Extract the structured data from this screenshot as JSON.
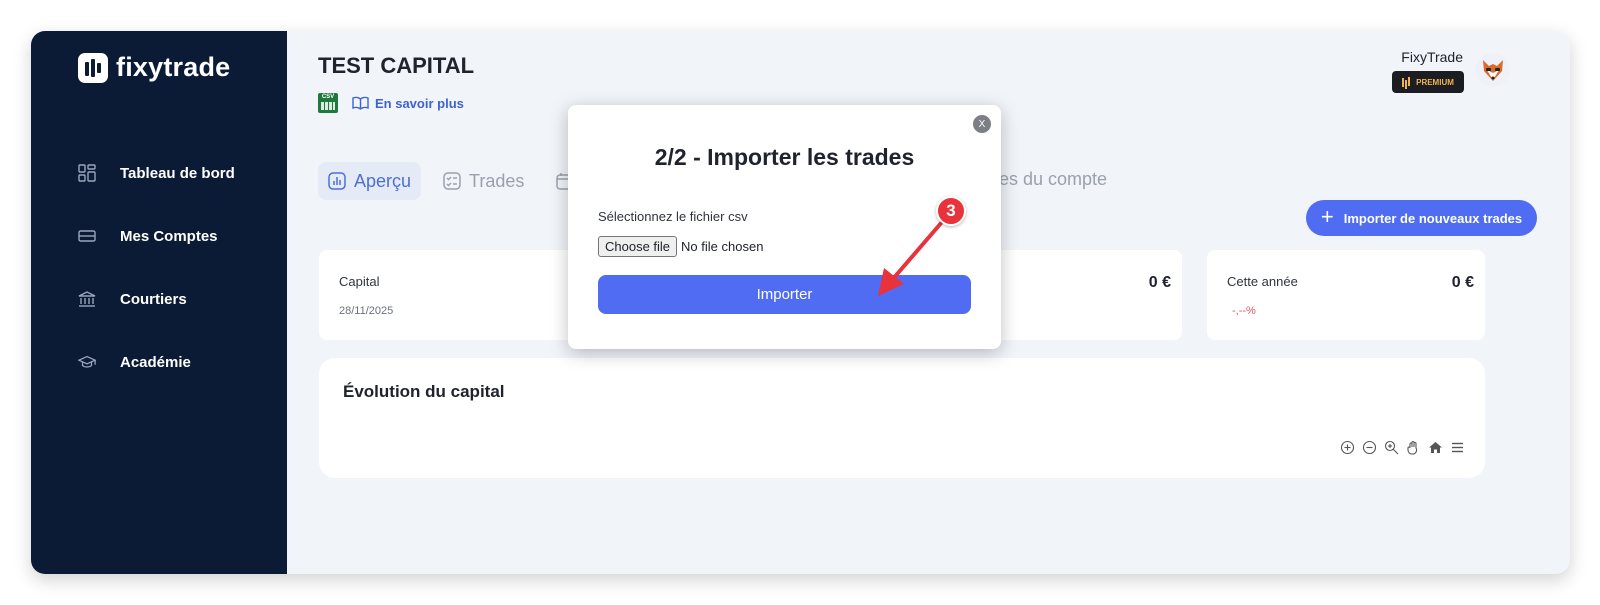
{
  "brand": {
    "name": "fixytrade"
  },
  "sidebar": {
    "items": [
      {
        "label": "Tableau de bord",
        "icon": "dashboard-icon"
      },
      {
        "label": "Mes Comptes",
        "icon": "card-icon"
      },
      {
        "label": "Courtiers",
        "icon": "bank-icon"
      },
      {
        "label": "Académie",
        "icon": "graduation-cap-icon"
      }
    ]
  },
  "header": {
    "account_title": "TEST CAPITAL",
    "csv_icon_text": "CSV",
    "learn_more": "En savoir plus",
    "user_name": "FixyTrade",
    "badge": "PREMIUM"
  },
  "tabs": [
    {
      "label": "Aperçu",
      "active": true
    },
    {
      "label": "Trades",
      "active": false
    }
  ],
  "tab_settings_partial": "tres du compte",
  "import_button": "Importer de nouveaux trades",
  "stats": [
    {
      "label": "Capital",
      "sub": "28/11/2025"
    },
    {
      "value": "0 €"
    },
    {
      "label": "Cette année",
      "value": "0 €",
      "pct": "-,--%"
    }
  ],
  "chart": {
    "title": "Évolution du capital",
    "tools": [
      "zoom-in-icon",
      "zoom-out-icon",
      "magnify-icon",
      "pan-hand-icon",
      "home-icon",
      "menu-icon"
    ]
  },
  "modal": {
    "close": "X",
    "title": "2/2 - Importer les trades",
    "label": "Sélectionnez le fichier csv",
    "file_button": "Choose file",
    "file_status": "No file chosen",
    "submit": "Importer"
  },
  "annotation": {
    "step": "3"
  },
  "colors": {
    "sidebar_bg": "#0b1b36",
    "accent": "#4f6cf2",
    "annotation": "#e8323c",
    "negative": "#e05763"
  }
}
